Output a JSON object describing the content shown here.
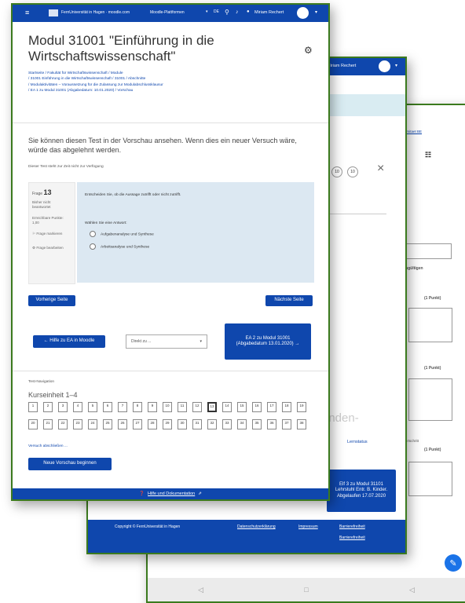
{
  "back_window": {
    "copyright_link": "Universitaet BE",
    "points_1": "(1 Punkt)",
    "points_2": "(1 Punkt)",
    "points_3": "(1 Punkt)",
    "label_ungueltig": "ungültigen",
    "label_fortschritt": "Fortschritt",
    "bottom_nav": [
      "◁",
      "□",
      "◁"
    ]
  },
  "middle_window": {
    "user_name": "Miriam Rechert",
    "pill_1": "10",
    "pill_2": "10",
    "faded_text": "enden-",
    "link_text": "Lernstatus",
    "next_activity_button": "Elf 3 zu Modul 31101 Lehrstuhl Entr. B. Kinder. Abgelaufen 17.07.2020",
    "footer_copyright": "Copyright © FernUniversität in Hagen",
    "footer_links": [
      "Datenschutzerklärung",
      "Impressum",
      "Barrierefreiheit",
      "Barrierefreiheit"
    ]
  },
  "front_window": {
    "navbar": {
      "site_label": "FernUniversität in Hagen · moodle.com",
      "nav_link": "Moodle-Plattformen",
      "user_name": "Miriam Rechert"
    },
    "page_title": "Modul 31001 \"Einführung in die Wirtschaftswissenschaft\"",
    "breadcrumbs": [
      "Startseite / Fakultät für Wirtschaftswissenschaft / Module",
      "/ 31001 Einführung in die Wirtschaftswissenschaft / 31001 / Abschnitte",
      "/ Modulaktivitäten – Voraussetzung für die Zulassung zur Modulabschlussklausur",
      "/ EA 1 zu Modul 31001 (Abgabedatum: 10.01.2020) / Vorschau"
    ],
    "preview_notice": "Sie können diesen Test in der Vorschau ansehen. Wenn dies ein neuer Versuch wäre, würde das abgelehnt werden.",
    "preview_subnote": "Dieser Test steht zur Zeit nicht zur Verfügung",
    "question_info": {
      "label": "Frage",
      "number": "13",
      "status": "Bisher nicht beantwortet",
      "points": "Erreichbare Punkte: 1,00",
      "flag": "Frage markieren",
      "edit": "Frage bearbeiten"
    },
    "question": {
      "text": "Entscheiden Sie, ob die Aussage zutrifft oder nicht zutrifft.",
      "prompt": "Wählen Sie eine Antwort:",
      "options": [
        "Aufgabenanalyse und Synthese",
        "Arbeitsanalyse und Synthese"
      ]
    },
    "prev_button": "Vorherige Seite",
    "next_button": "Nächste Seite",
    "back_button": "← Hilfe zu EA in Moodle",
    "jump_select": "Direkt zu ...",
    "next_activity_button": "EA 2 zu Modul 31001 (Abgabedatum 13.01.2020) →",
    "nav_heading": "Test-Navigation",
    "nav_title": "Kurseinheit 1–4",
    "question_numbers": [
      "1",
      "2",
      "3",
      "4",
      "5",
      "6",
      "7",
      "8",
      "9",
      "10",
      "11",
      "12",
      "13",
      "14",
      "15",
      "16",
      "17",
      "18",
      "19",
      "20",
      "21",
      "22",
      "23",
      "24",
      "25",
      "26",
      "27",
      "28",
      "29",
      "30",
      "31",
      "32",
      "33",
      "34",
      "35",
      "36",
      "37",
      "38"
    ],
    "current_question": "13",
    "finish_link": "Versuch abschließen ...",
    "new_preview_button": "Neue Vorschau beginnen",
    "footer_link": "Hilfe und Dokumentation"
  },
  "colors": {
    "primary": "#0f47ad",
    "frame_green": "#3b7a1e",
    "question_bg": "#dce8f2",
    "banner_bg": "#d9ecf2"
  }
}
